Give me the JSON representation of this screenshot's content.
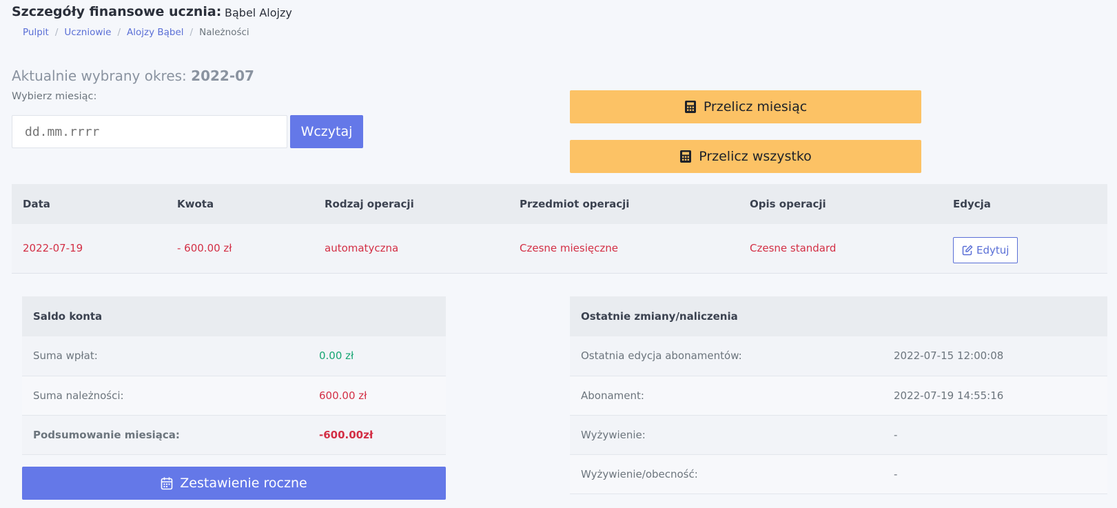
{
  "header": {
    "title": "Szczegóły finansowe ucznia:",
    "student": "Bąbel Alojzy"
  },
  "breadcrumb": {
    "items": [
      "Pulpit",
      "Uczniowie",
      "Alojzy Bąbel"
    ],
    "current": "Należności"
  },
  "period": {
    "label": "Aktualnie wybrany okres:",
    "value": "2022-07"
  },
  "month_picker": {
    "label": "Wybierz miesiąc:",
    "placeholder": "dd.mm.rrrr",
    "load_label": "Wczytaj"
  },
  "actions": {
    "recalc_month": "Przelicz miesiąc",
    "recalc_all": "Przelicz wszystko"
  },
  "operations": {
    "headers": [
      "Data",
      "Kwota",
      "Rodzaj operacji",
      "Przedmiot operacji",
      "Opis operacji",
      "Edycja"
    ],
    "rows": [
      {
        "date": "2022-07-19",
        "amount": "- 600.00 zł",
        "type": "automatyczna",
        "subject": "Czesne miesięczne",
        "description": "Czesne standard",
        "edit_label": "Edytuj"
      }
    ]
  },
  "balance": {
    "title": "Saldo konta",
    "rows": [
      {
        "label": "Suma wpłat:",
        "value": "0.00 zł"
      },
      {
        "label": "Suma należności:",
        "value": "600.00 zł"
      },
      {
        "label": "Podsumowanie miesiąca:",
        "value": "-600.00zł"
      }
    ],
    "yearly_label": "Zestawienie roczne"
  },
  "changes": {
    "title": "Ostatnie zmiany/naliczenia",
    "rows": [
      {
        "label": "Ostatnia edycja abonamentów:",
        "value": "2022-07-15 12:00:08"
      },
      {
        "label": "Abonament:",
        "value": "2022-07-19 14:55:16"
      },
      {
        "label": "Wyżywienie:",
        "value": "-"
      },
      {
        "label": "Wyżywienie/obecność:",
        "value": "-"
      }
    ]
  },
  "colors": {
    "primary": "#6478e8",
    "warning": "#fcc265",
    "danger": "#d32f45",
    "success": "#17a673"
  },
  "icons": {
    "recalc": "calculator-icon",
    "edit": "edit-icon",
    "yearly": "calendar-icon"
  }
}
